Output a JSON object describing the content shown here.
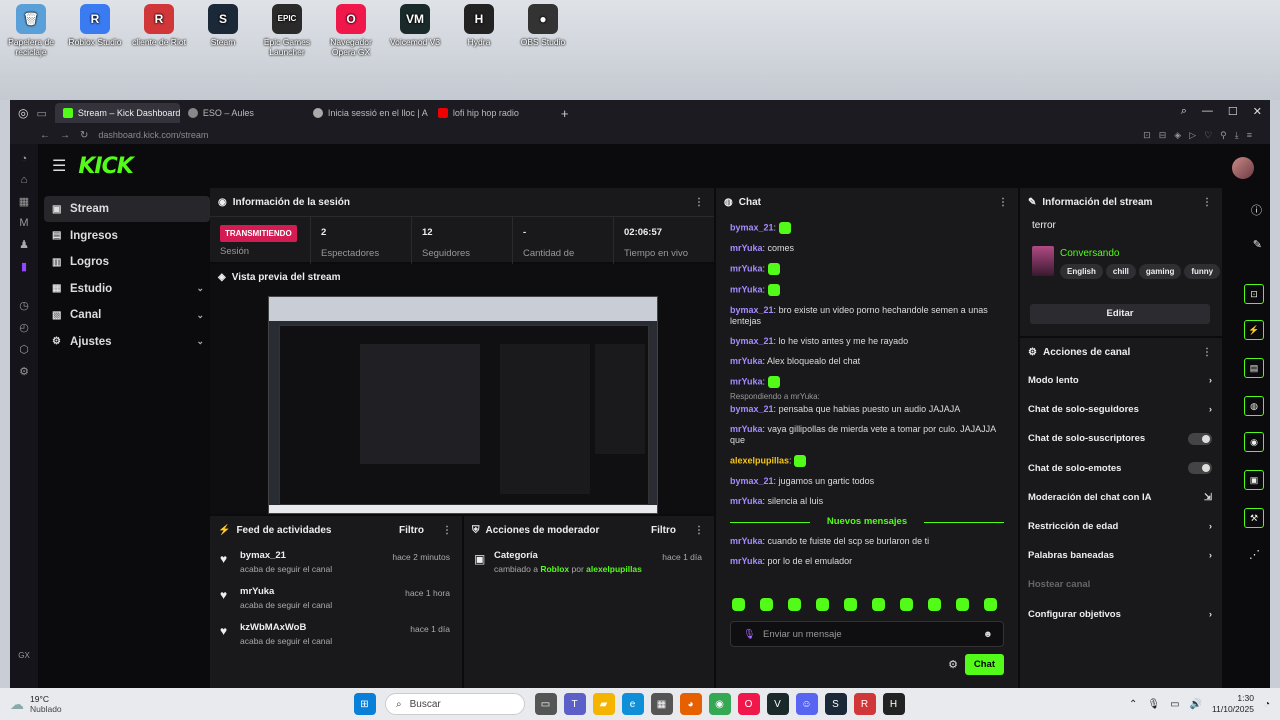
{
  "desktop_icons": [
    {
      "label": "Papelera de reciclaje",
      "color": "#5aa0d8",
      "glyph": "🗑"
    },
    {
      "label": "Roblox Studio",
      "color": "#3a7bf2",
      "glyph": "R"
    },
    {
      "label": "cliente de Riot",
      "color": "#d13639",
      "glyph": "R"
    },
    {
      "label": "Steam",
      "color": "#1b2838",
      "glyph": "S"
    },
    {
      "label": "Epic Games Launcher",
      "color": "#2a2a2a",
      "glyph": "EPIC"
    },
    {
      "label": "Navegador Opera GX",
      "color": "#f0174a",
      "glyph": "O"
    },
    {
      "label": "Voicemod V3",
      "color": "#1a2a2a",
      "glyph": "VM"
    },
    {
      "label": "Hydra",
      "color": "#222",
      "glyph": "H"
    },
    {
      "label": "OBS Studio",
      "color": "#333",
      "glyph": "●"
    }
  ],
  "browser": {
    "tabs": [
      "Stream – Kick Dashboard",
      "ESO – Aules",
      "Inicia sessió en el lloc | A",
      "lofi hip hop radio"
    ],
    "url": "dashboard.kick.com/stream"
  },
  "kick": {
    "logo": "KICK",
    "nav": [
      {
        "label": "Stream",
        "icon": "▣",
        "chev": ""
      },
      {
        "label": "Ingresos",
        "icon": "▤",
        "chev": ""
      },
      {
        "label": "Logros",
        "icon": "▥",
        "chev": ""
      },
      {
        "label": "Estudio",
        "icon": "▦",
        "chev": "⌄"
      },
      {
        "label": "Canal",
        "icon": "▧",
        "chev": "⌄"
      },
      {
        "label": "Ajustes",
        "icon": "⚙",
        "chev": "⌄"
      }
    ],
    "session": {
      "title": "Información de la sesión",
      "status": "TRANSMITIENDO",
      "status_label": "Sesión",
      "viewers": "2",
      "viewers_label": "Espectadores",
      "followers": "12",
      "followers_label": "Seguidores",
      "amount": "-",
      "amount_label": "Cantidad de",
      "time": "02:06:57",
      "time_label": "Tiempo en vivo",
      "preview_title": "Vista previa del stream"
    },
    "feed": {
      "title": "Feed de actividades",
      "filter": "Filtro",
      "items": [
        {
          "name": "bymax_21",
          "sub": "acaba de seguir el canal",
          "time": "hace 2 minutos"
        },
        {
          "name": "mrYuka",
          "sub": "acaba de seguir el canal",
          "time": "hace 1 hora"
        },
        {
          "name": "kzWbMAxWoB",
          "sub": "acaba de seguir el canal",
          "time": "hace 1 día"
        }
      ]
    },
    "mod": {
      "title": "Acciones de moderador",
      "filter": "Filtro",
      "item_title": "Categoría",
      "item_pre": "cambiado a ",
      "item_cat": "Roblox",
      "item_mid": " por ",
      "item_user": "alexelpupillas",
      "item_time": "hace 1 día"
    },
    "chat": {
      "title": "Chat",
      "messages": [
        {
          "user": "bymax_21",
          "color": "#a58bff",
          "text": "",
          "emoji": true
        },
        {
          "user": "mrYuka",
          "color": "#a58bff",
          "text": "comes",
          "emoji": false
        },
        {
          "user": "mrYuka",
          "color": "#a58bff",
          "text": "",
          "emoji": true
        },
        {
          "user": "mrYuka",
          "color": "#a58bff",
          "text": "",
          "emoji": true
        },
        {
          "user": "bymax_21",
          "color": "#a58bff",
          "text": "bro existe un video porno hechandole semen a unas lentejas",
          "emoji": false
        },
        {
          "user": "bymax_21",
          "color": "#a58bff",
          "text": "lo he visto antes y me he rayado",
          "emoji": false
        },
        {
          "user": "mrYuka",
          "color": "#a58bff",
          "text": "Alex bloquealo del chat",
          "emoji": false
        },
        {
          "user": "mrYuka",
          "color": "#a58bff",
          "text": "",
          "emoji": true
        },
        {
          "user": "bymax_21",
          "color": "#a58bff",
          "text": "pensaba que habias puesto un audio JAJAJA",
          "emoji": false,
          "reply": "Respondiendo a mrYuka:"
        },
        {
          "user": "mrYuka",
          "color": "#a58bff",
          "text": "vaya gillipollas de mierda vete a tomar por culo. JAJAJJA que",
          "emoji": false
        },
        {
          "user": "alexelpupillas",
          "color": "#f5c518",
          "text": "",
          "emoji": true
        },
        {
          "user": "bymax_21",
          "color": "#a58bff",
          "text": "jugamos un gartic todos",
          "emoji": false
        },
        {
          "user": "mrYuka",
          "color": "#a58bff",
          "text": "silencia al luis",
          "emoji": false
        }
      ],
      "new_messages": "Nuevos mensajes",
      "messages_after": [
        {
          "user": "mrYuka",
          "color": "#a58bff",
          "text": "cuando te fuiste del scp se burlaron de ti"
        },
        {
          "user": "mrYuka",
          "color": "#a58bff",
          "text": "por lo de el emulador"
        }
      ],
      "placeholder": "Enviar un mensaje",
      "send": "Chat"
    },
    "stream_info": {
      "title": "Información del stream",
      "stream_title": "terror",
      "category": "Conversando",
      "tags": [
        "English",
        "chill",
        "gaming",
        "funny"
      ],
      "edit": "Editar"
    },
    "channel_actions": {
      "title": "Acciones de canal",
      "items": [
        {
          "label": "Modo lento",
          "kind": "arrow"
        },
        {
          "label": "Chat de solo-seguidores",
          "kind": "arrow"
        },
        {
          "label": "Chat de solo-suscriptores",
          "kind": "toggle"
        },
        {
          "label": "Chat de solo-emotes",
          "kind": "toggle"
        },
        {
          "label": "Moderación del chat con IA",
          "kind": "ext"
        },
        {
          "label": "Restricción de edad",
          "kind": "arrow"
        },
        {
          "label": "Palabras baneadas",
          "kind": "arrow"
        },
        {
          "label": "Hostear canal",
          "kind": "disabled"
        },
        {
          "label": "Configurar objetivos",
          "kind": "arrow"
        }
      ]
    }
  },
  "taskbar": {
    "weather_temp": "19°C",
    "weather_text": "Nublado",
    "search": "Buscar",
    "time": "1:30",
    "date": "11/10/2025"
  }
}
